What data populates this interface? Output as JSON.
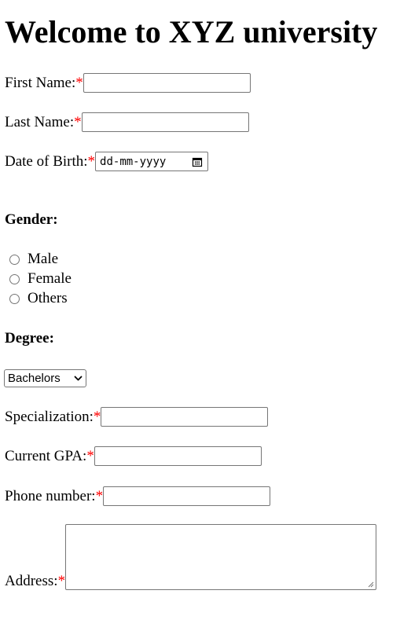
{
  "header": {
    "title": "Welcome to XYZ university"
  },
  "form": {
    "first_name": {
      "label": "First Name:",
      "required": "*",
      "value": ""
    },
    "last_name": {
      "label": "Last Name:",
      "required": "*",
      "value": ""
    },
    "dob": {
      "label": "Date of Birth:",
      "required": "*",
      "placeholder": "dd-mm-yyyy",
      "icon": "calendar-icon"
    },
    "gender": {
      "label": "Gender:",
      "options": [
        "Male",
        "Female",
        "Others"
      ]
    },
    "degree": {
      "label": "Degree:",
      "selected": "Bachelors",
      "icon": "chevron-down-icon"
    },
    "specialization": {
      "label": "Specialization:",
      "required": "*",
      "value": ""
    },
    "gpa": {
      "label": "Current GPA:",
      "required": "*",
      "value": ""
    },
    "phone": {
      "label": "Phone number:",
      "required": "*",
      "value": ""
    },
    "address": {
      "label": "Address:",
      "required": "*",
      "value": "",
      "icon": "resize-grip-icon"
    }
  },
  "colors": {
    "required": "#ff0000",
    "border": "#767676"
  }
}
